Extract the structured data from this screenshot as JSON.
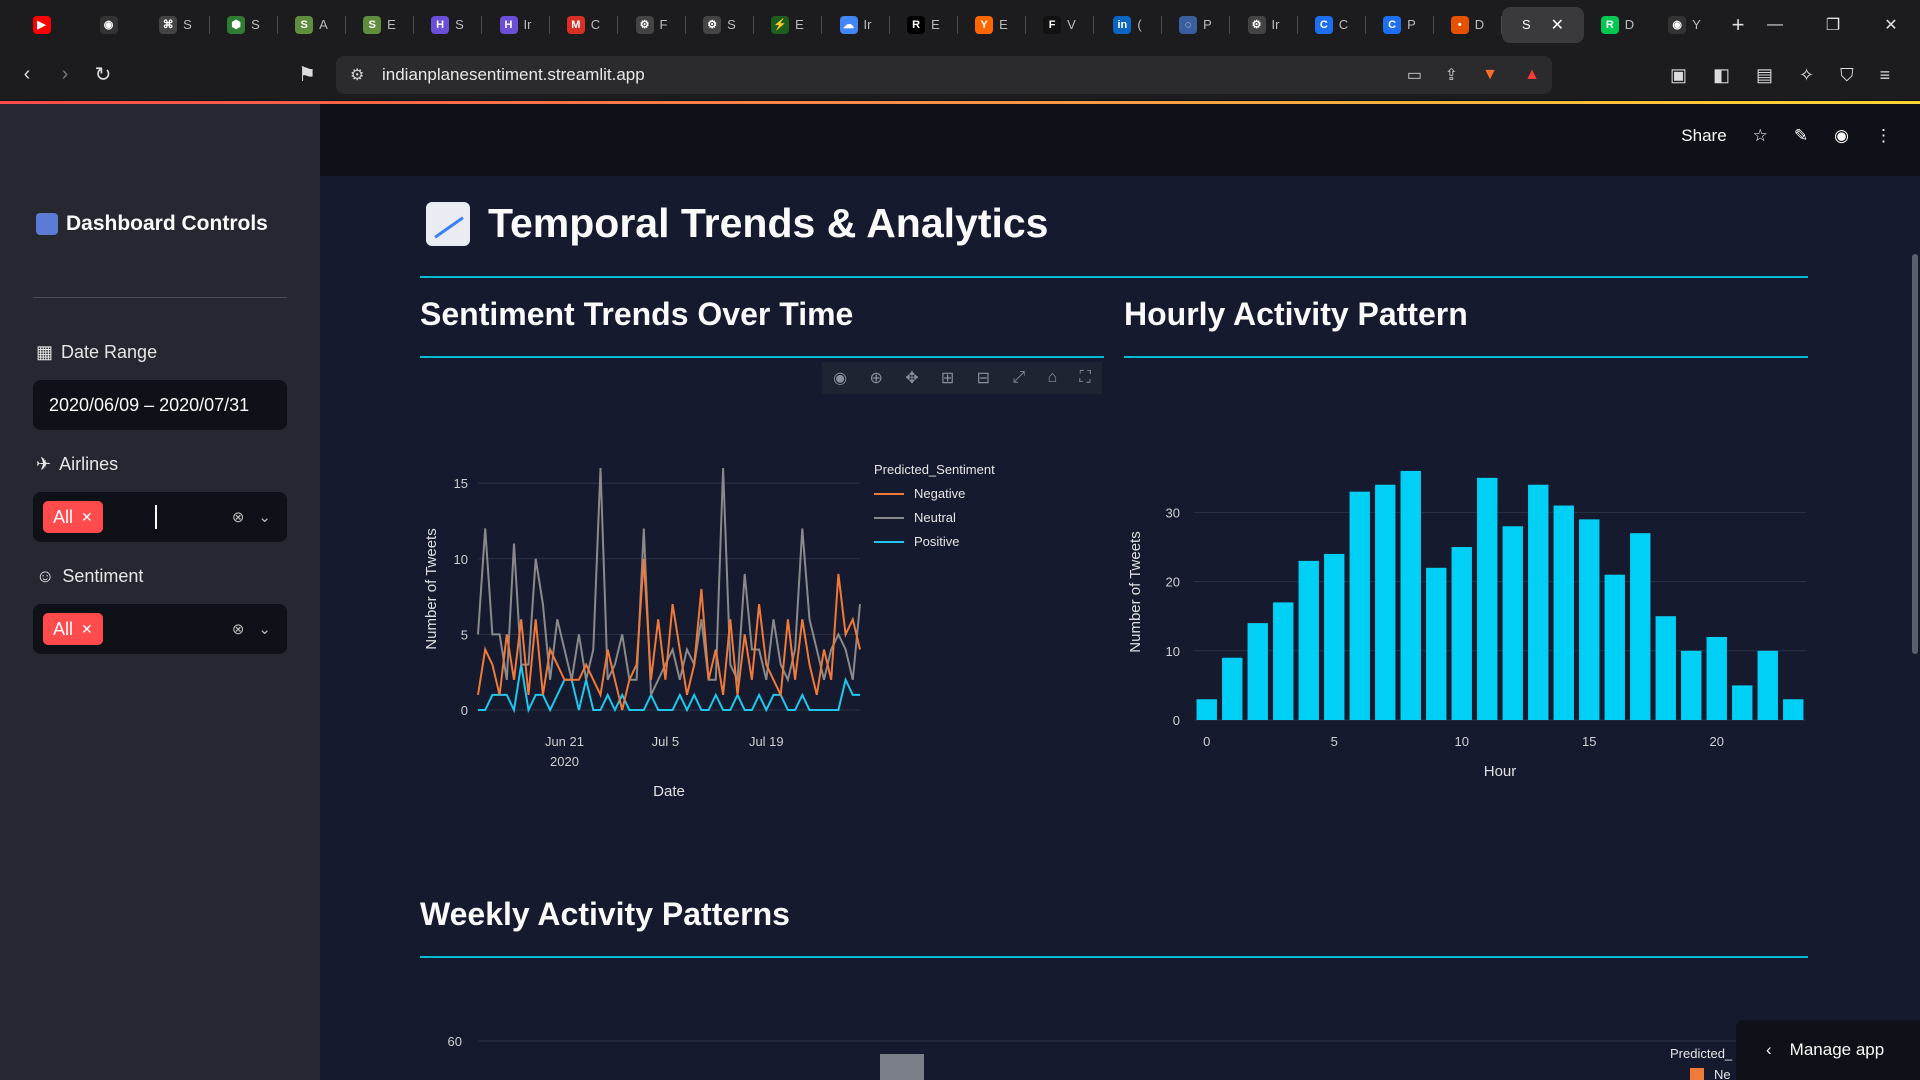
{
  "browser": {
    "tabs": [
      {
        "icon": "youtube-icon",
        "letter": "▶",
        "color": "#ff0000",
        "label": ""
      },
      {
        "icon": "github-icon",
        "letter": "◉",
        "color": "#333333",
        "label": ""
      },
      {
        "icon": "command-icon",
        "letter": "⌘",
        "color": "#444444",
        "label": "S"
      },
      {
        "icon": "hex-icon",
        "letter": "⬢",
        "color": "#2e7d32",
        "label": "S"
      },
      {
        "icon": "shopify-icon",
        "letter": "S",
        "color": "#5e8e3e",
        "label": "A"
      },
      {
        "icon": "shopify-icon",
        "letter": "S",
        "color": "#5e8e3e",
        "label": "E"
      },
      {
        "icon": "h-icon",
        "letter": "H",
        "color": "#6b4fd8",
        "label": "S"
      },
      {
        "icon": "h-icon",
        "letter": "H",
        "color": "#6b4fd8",
        "label": "Ir"
      },
      {
        "icon": "gmail-icon",
        "letter": "M",
        "color": "#d93025",
        "label": "C"
      },
      {
        "icon": "openai-icon",
        "letter": "⚙",
        "color": "#444444",
        "label": "F"
      },
      {
        "icon": "openai-icon",
        "letter": "⚙",
        "color": "#444444",
        "label": "S"
      },
      {
        "icon": "bolt-icon",
        "letter": "⚡",
        "color": "#1b5e20",
        "label": "E"
      },
      {
        "icon": "cloud-icon",
        "letter": "☁",
        "color": "#4285f4",
        "label": "Ir"
      },
      {
        "icon": "r-icon",
        "letter": "R",
        "color": "#000000",
        "label": "E"
      },
      {
        "icon": "y-icon",
        "letter": "Y",
        "color": "#ff6600",
        "label": "E"
      },
      {
        "icon": "framer-icon",
        "letter": "F",
        "color": "#111111",
        "label": "V"
      },
      {
        "icon": "linkedin-icon",
        "letter": "in",
        "color": "#0a66c2",
        "label": "("
      },
      {
        "icon": "swirl-icon",
        "letter": "◌",
        "color": "#3a5f9e",
        "label": "P"
      },
      {
        "icon": "openai-icon",
        "letter": "⚙",
        "color": "#444444",
        "label": "Ir"
      },
      {
        "icon": "c-icon",
        "letter": "C",
        "color": "#1e6ef2",
        "label": "C"
      },
      {
        "icon": "c-icon",
        "letter": "C",
        "color": "#1e6ef2",
        "label": "P"
      },
      {
        "icon": "flame-icon",
        "letter": "•",
        "color": "#e65100",
        "label": "D"
      }
    ],
    "active_tab_label": "S",
    "after_tabs": [
      {
        "icon": "r-green-icon",
        "letter": "R",
        "color": "#00c853",
        "label": "D"
      },
      {
        "icon": "github-icon",
        "letter": "◉",
        "color": "#333333",
        "label": "Y"
      }
    ],
    "url": "indianplanesentiment.streamlit.app",
    "brave_badge": "2",
    "alert_badge": "1"
  },
  "sidebar": {
    "title": "Dashboard Controls",
    "date_label": "Date Range",
    "date_value": "2020/06/09 – 2020/07/31",
    "airlines_label": "Airlines",
    "airlines_selected": "All",
    "sentiment_label": "Sentiment",
    "sentiment_selected": "All"
  },
  "topbar": {
    "share_label": "Share"
  },
  "page": {
    "title": "Temporal Trends & Analytics",
    "section1": "Sentiment Trends Over Time",
    "section2": "Hourly Activity Pattern",
    "section3": "Weekly Activity Patterns",
    "manage_label": "Manage app"
  },
  "chart_data": [
    {
      "type": "line",
      "xlabel": "Date",
      "ylabel": "Number of Tweets",
      "x_tick_labels": [
        "Jun 21",
        "Jul 5",
        "Jul 19"
      ],
      "x_tick_sublabel": "2020",
      "y_ticks": [
        0,
        5,
        10,
        15
      ],
      "ylim": [
        0,
        16
      ],
      "legend_title": "Predicted_Sentiment",
      "legend_position": "top-right",
      "series": [
        {
          "name": "Negative",
          "color": "#ef7a3a",
          "values": [
            1,
            4,
            3,
            1,
            5,
            2,
            6,
            1,
            6,
            1,
            4,
            3,
            2,
            2,
            2,
            3,
            2,
            1,
            4,
            2,
            0,
            2,
            3,
            10,
            2,
            6,
            2,
            7,
            4,
            1,
            3,
            8,
            2,
            4,
            1,
            6,
            1,
            5,
            2,
            7,
            3,
            2,
            1,
            6,
            2,
            6,
            3,
            1,
            4,
            2,
            9,
            5,
            6,
            4
          ]
        },
        {
          "name": "Neutral",
          "color": "#8a8a8a",
          "values": [
            5,
            12,
            5,
            5,
            2,
            11,
            3,
            3,
            10,
            7,
            2,
            6,
            4,
            2,
            5,
            2,
            4,
            16,
            2,
            3,
            5,
            2,
            2,
            12,
            1,
            2,
            3,
            4,
            2,
            4,
            3,
            6,
            2,
            2,
            16,
            3,
            2,
            9,
            4,
            4,
            2,
            6,
            3,
            2,
            4,
            12,
            6,
            4,
            2,
            4,
            5,
            4,
            2,
            7
          ]
        },
        {
          "name": "Positive",
          "color": "#1ec8ec",
          "values": [
            0,
            0,
            1,
            1,
            1,
            0,
            3,
            0,
            1,
            1,
            0,
            1,
            2,
            2,
            0,
            2,
            0,
            0,
            1,
            0,
            1,
            0,
            0,
            0,
            1,
            0,
            0,
            0,
            1,
            0,
            1,
            0,
            0,
            1,
            0,
            0,
            1,
            0,
            0,
            1,
            0,
            1,
            1,
            0,
            0,
            1,
            0,
            0,
            0,
            0,
            0,
            2,
            1,
            1
          ]
        }
      ]
    },
    {
      "type": "bar",
      "xlabel": "Hour",
      "ylabel": "Number of Tweets",
      "categories": [
        0,
        1,
        2,
        3,
        4,
        5,
        6,
        7,
        8,
        9,
        10,
        11,
        12,
        13,
        14,
        15,
        16,
        17,
        18,
        19,
        20,
        21,
        22,
        23
      ],
      "values": [
        3,
        9,
        14,
        17,
        23,
        24,
        33,
        34,
        36,
        22,
        25,
        35,
        28,
        34,
        31,
        29,
        21,
        27,
        15,
        10,
        12,
        5,
        10,
        3
      ],
      "x_ticks": [
        0,
        5,
        10,
        15,
        20
      ],
      "y_ticks": [
        0,
        10,
        20,
        30
      ],
      "ylim": [
        0,
        37
      ],
      "color": "#00d0f5"
    },
    {
      "type": "bar",
      "y_ticks_visible": [
        60
      ],
      "legend_title": "Predicted_",
      "legend_visible_entry": "Ne",
      "legend_color": "#ef7a3a",
      "partial": true
    }
  ]
}
